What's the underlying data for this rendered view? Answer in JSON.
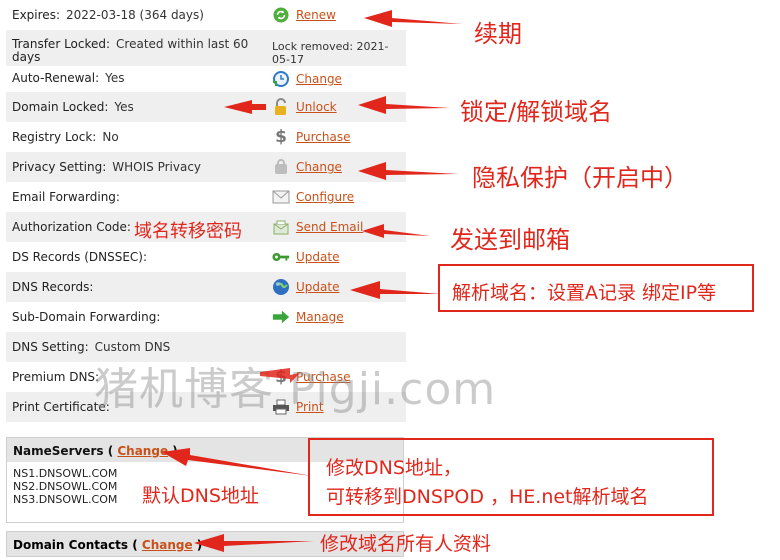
{
  "rows": [
    {
      "label": "Expires:",
      "value": "2022-03-18 (364 days)",
      "action": "Renew",
      "icon": "renew-icon"
    },
    {
      "label": "Transfer Locked:",
      "value": "Created within last 60",
      "value2": "days",
      "right": "Lock removed: 2021-",
      "right2": "05-17"
    },
    {
      "label": "Auto-Renewal:",
      "value": "Yes",
      "action": "Change",
      "icon": "clock-icon"
    },
    {
      "label": "Domain Locked:",
      "value": "Yes",
      "action": "Unlock",
      "icon": "lock-icon"
    },
    {
      "label": "Registry Lock:",
      "value": "No",
      "action": "Purchase",
      "icon": "dollar-icon"
    },
    {
      "label": "Privacy Setting:",
      "value": "WHOIS Privacy",
      "action": "Change",
      "icon": "privacy-icon"
    },
    {
      "label": "Email Forwarding:",
      "value": "",
      "action": "Configure",
      "icon": "envelope-icon"
    },
    {
      "label": "Authorization Code:",
      "value": "",
      "action": "Send Email",
      "icon": "mail-send-icon"
    },
    {
      "label": "DS Records (DNSSEC):",
      "value": "",
      "action": "Update",
      "icon": "key-icon"
    },
    {
      "label": "DNS Records:",
      "value": "",
      "action": "Update",
      "icon": "globe-icon"
    },
    {
      "label": "Sub-Domain Forwarding:",
      "value": "",
      "action": "Manage",
      "icon": "arrow-right-icon"
    },
    {
      "label": "DNS Setting:",
      "value": "Custom DNS",
      "action": "",
      "icon": ""
    },
    {
      "label": "Premium DNS:",
      "value": "",
      "action": "Purchase",
      "icon": "dollar-icon"
    },
    {
      "label": "Print Certificate:",
      "value": "",
      "action": "Print",
      "icon": "printer-icon"
    }
  ],
  "nameservers": {
    "title": "NameServers",
    "change_label": "Change",
    "servers": [
      "NS1.DNSOWL.COM",
      "NS2.DNSOWL.COM",
      "NS3.DNSOWL.COM"
    ]
  },
  "domain_contacts": {
    "title": "Domain Contacts",
    "change_label": "Change"
  },
  "annotations": {
    "renew": "续期",
    "lock": "锁定/解锁域名",
    "privacy": "隐私保护（开启中）",
    "auth_code": "域名转移密码",
    "send_email": "发送到邮箱",
    "dns_records": "解析域名：设置A记录 绑定IP等",
    "ns_edit_line1": "修改DNS地址，",
    "ns_edit_line2": "可转移到DNSPOD ，HE.net解析域名",
    "ns_default": "默认DNS地址",
    "contacts": "修改域名所有人资料"
  },
  "watermark": "猪机博客 Pigji.com",
  "colors": {
    "accent": "#e1261c",
    "link": "#c8511a"
  }
}
